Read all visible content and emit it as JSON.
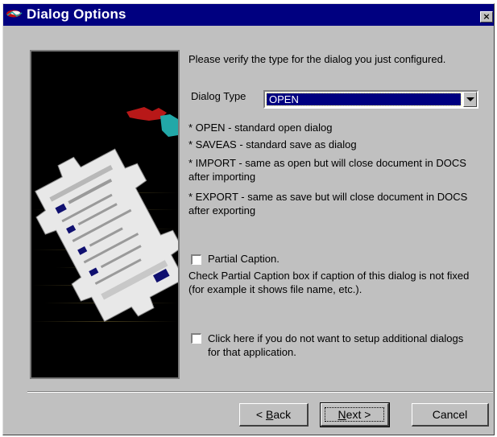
{
  "window": {
    "title": "Dialog Options",
    "close_glyph": "×"
  },
  "intro": "Please verify the type for the dialog you just configured.",
  "dialog_type": {
    "label": "Dialog Type",
    "selected": "OPEN"
  },
  "descriptions": [
    "* OPEN - standard open dialog",
    "* SAVEAS - standard save as dialog",
    "* IMPORT - same as open but will close document in DOCS after importing",
    "* EXPORT - same as save but will close document in DOCS after exporting"
  ],
  "partial_caption": {
    "label": "Partial Caption.",
    "checked": false,
    "help": "Check Partial Caption box if caption of this dialog is not fixed (for example it shows file name, etc.)."
  },
  "no_more_dialogs": {
    "label": "Click here if you do not want to setup additional dialogs for that application.",
    "checked": false
  },
  "buttons": {
    "back": {
      "prefix": "< ",
      "mnemonic": "B",
      "rest": "ack"
    },
    "next": {
      "mnemonic": "N",
      "rest": "ext",
      "suffix": " >"
    },
    "cancel": "Cancel"
  },
  "icons": {
    "title": "app-icon",
    "close": "close-icon",
    "art": "gear-puzzle-illustration"
  },
  "colors": {
    "titlebar": "#000080",
    "face": "#c0c0c0",
    "selection": "#000080"
  }
}
